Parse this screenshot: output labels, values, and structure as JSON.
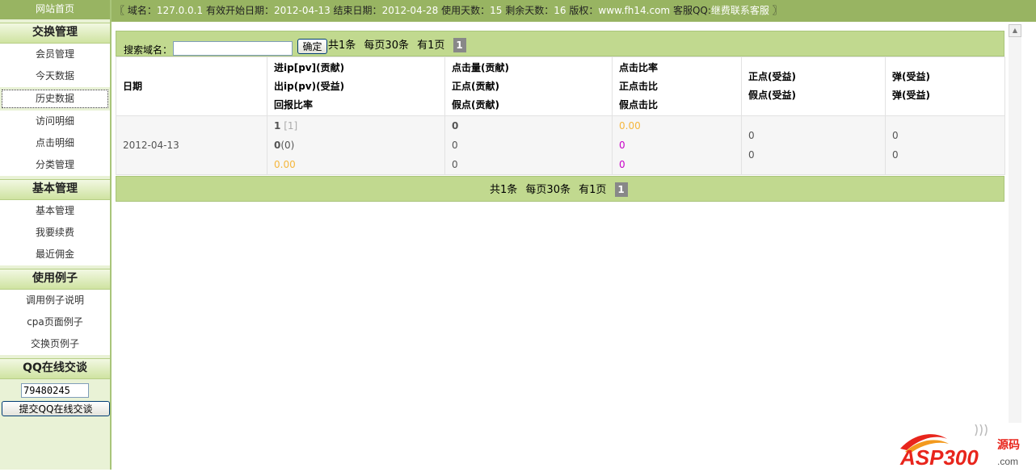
{
  "sidebar": {
    "home": "网站首页",
    "sections": [
      {
        "title": "交换管理",
        "items": [
          "会员管理",
          "今天数据",
          "历史数据",
          "访问明细",
          "点击明细",
          "分类管理"
        ]
      },
      {
        "title": "基本管理",
        "items": [
          "基本管理",
          "我要续费",
          "最近佣金"
        ]
      },
      {
        "title": "使用例子",
        "items": [
          "调用例子说明",
          "cpa页面例子",
          "交换页例子"
        ]
      }
    ],
    "qq_title": "QQ在线交谈",
    "qq_value": "79480245",
    "qq_submit": "提交QQ在线交谈"
  },
  "topbar": {
    "open": "〖",
    "domain_label": "域名：",
    "domain": "127.0.0.1",
    "start_label": "有效开始日期：",
    "start": "2012-04-13",
    "end_label": "结束日期：",
    "end": "2012-04-28",
    "used_label": "使用天数：",
    "used": "15",
    "left_label": "剩余天数：",
    "left": "16",
    "copyright_label": "版权：",
    "copyright": "www.fh14.com",
    "qq_label": "客服QQ:",
    "qq": "继费联系客服",
    "close": "〗"
  },
  "search": {
    "label": "搜索域名：",
    "value": "",
    "button": "确定"
  },
  "pager": {
    "total": "共1条",
    "per_page": "每页30条",
    "pages": "有1页",
    "current": "1"
  },
  "table": {
    "header": {
      "date": "日期",
      "col2": [
        "进ip[pv](贡献)",
        "出ip(pv)(受益)",
        "回报比率"
      ],
      "col3": [
        "点击量(贡献)",
        "正点(贡献)",
        "假点(贡献)"
      ],
      "col4": [
        "点击比率",
        "正点击比",
        "假点击比"
      ],
      "col5": [
        "正点(受益)",
        "假点(受益)"
      ],
      "col6": [
        "弹(受益)",
        "弹(受益)"
      ]
    },
    "rows": [
      {
        "date": "2012-04-13",
        "in_ip": "1",
        "in_pv": "[1]",
        "out_ip": "0",
        "out_pv": "(0)",
        "return_ratio": "0.00",
        "clicks": "0",
        "real_clicks": "0",
        "fake_clicks": "0",
        "click_ratio": "0.00",
        "real_ratio": "0",
        "fake_ratio": "0",
        "real_benefit": "0",
        "fake_benefit": "0",
        "pop1": "0",
        "pop2": "0"
      }
    ]
  },
  "colors": {
    "accent": "#98b462",
    "bar": "#c1d98f",
    "sidebar_bg": "#e9f2d6",
    "orange": "#f5b73d",
    "magenta": "#c800c8"
  },
  "watermark": {
    "brand": "ASP300",
    "suffix": "源码",
    "domain": ".com"
  }
}
